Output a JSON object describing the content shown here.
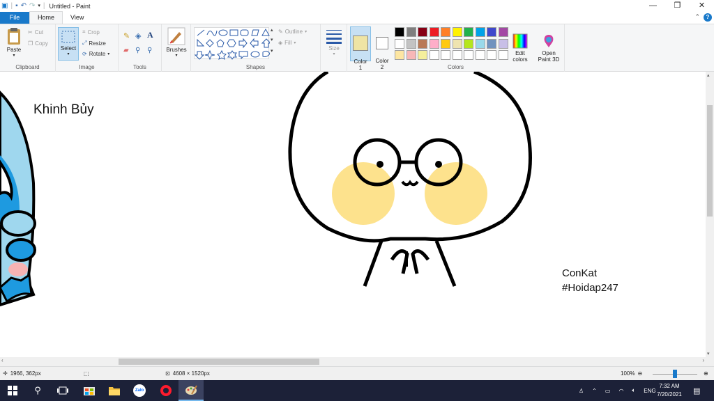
{
  "window": {
    "title": "Untitled - Paint",
    "controls": {
      "minimize": "—",
      "restore": "❐",
      "close": "✕"
    }
  },
  "tabs": [
    {
      "label": "File"
    },
    {
      "label": "Home"
    },
    {
      "label": "View"
    }
  ],
  "ribbon": {
    "clipboard": {
      "label": "Clipboard",
      "paste": "Paste",
      "cut": "Cut",
      "copy": "Copy"
    },
    "image": {
      "label": "Image",
      "select": "Select",
      "crop": "Crop",
      "resize": "Resize",
      "rotate": "Rotate"
    },
    "tools": {
      "label": "Tools"
    },
    "brushes": {
      "label": "Brushes"
    },
    "shapes": {
      "label": "Shapes",
      "outline": "Outline",
      "fill": "Fill"
    },
    "size": {
      "label": "Size"
    },
    "colors": {
      "label": "Colors",
      "color1": "Color\n1",
      "color2": "Color\n2",
      "color1_value": "#efe4a4",
      "color2_value": "#ffffff",
      "edit_colors": "Edit\ncolors",
      "palette": [
        [
          "#000000",
          "#7f7f7f",
          "#880015",
          "#ed1c24",
          "#ff7f27",
          "#fff200",
          "#22b14c",
          "#00a2e8",
          "#3f48cc",
          "#a349a4"
        ],
        [
          "#ffffff",
          "#c3c3c3",
          "#b97a57",
          "#ffaec9",
          "#ffc90e",
          "#efe4b0",
          "#b5e61d",
          "#99d9ea",
          "#7092be",
          "#c8bfe7"
        ],
        [
          "#fde6a2",
          "#f7b7b7",
          "#f5ef9c",
          "#ffffff",
          "#ffffff",
          "#ffffff",
          "#ffffff",
          "#ffffff",
          "#ffffff",
          "#ffffff"
        ]
      ]
    },
    "paint3d": {
      "label": "Open\nPaint 3D"
    }
  },
  "canvas": {
    "text_top_left": "Khinh Bủy",
    "signature_line1": "ConKat",
    "signature_line2": "#Hoidap247",
    "stroke_color": "#000000",
    "blush_color": "#fde28d",
    "blue_color": "#1e9ae0",
    "light_blue_color": "#9fd7ee",
    "pink_color": "#f7b3b3"
  },
  "statusbar": {
    "cursor_pos": "1966, 362px",
    "image_size": "4608 × 1520px",
    "zoom": "100%"
  },
  "taskbar": {
    "tray_lang": "ENG",
    "time": "7:32 AM",
    "date": "7/20/2021"
  }
}
